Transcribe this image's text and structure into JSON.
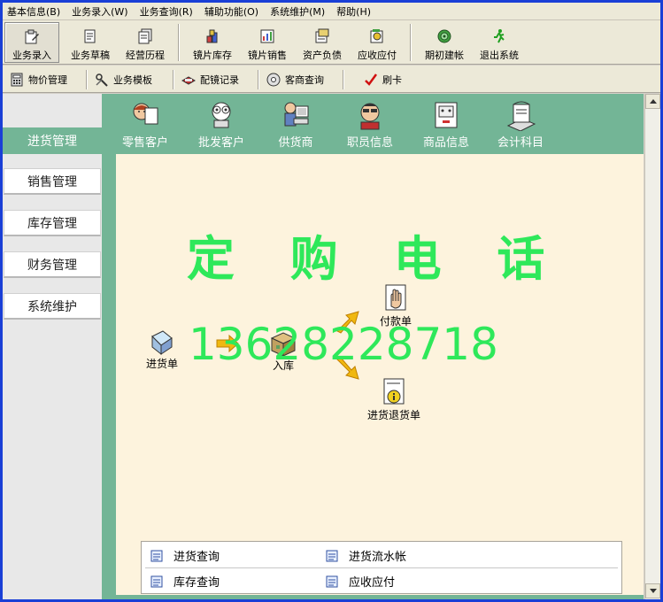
{
  "menu": [
    "基本信息(B)",
    "业务录入(W)",
    "业务查询(R)",
    "辅助功能(O)",
    "系统维护(M)",
    "帮助(H)"
  ],
  "toolbar1": {
    "items": [
      {
        "label": "业务录入",
        "icon": "edit-doc-icon"
      },
      {
        "label": "业务草稿",
        "icon": "draft-doc-icon"
      },
      {
        "label": "经营历程",
        "icon": "history-doc-icon"
      },
      {
        "label": "镜片库存",
        "icon": "stock-icon"
      },
      {
        "label": "镜片销售",
        "icon": "sales-icon"
      },
      {
        "label": "资产负债",
        "icon": "balance-icon"
      },
      {
        "label": "应收应付",
        "icon": "receivable-icon"
      },
      {
        "label": "期初建帐",
        "icon": "target-icon"
      },
      {
        "label": "退出系统",
        "icon": "exit-runner-icon"
      }
    ]
  },
  "toolbar2": {
    "items": [
      {
        "label": "物价管理",
        "icon": "calculator-icon"
      },
      {
        "label": "业务模板",
        "icon": "template-icon"
      },
      {
        "label": "配镜记录",
        "icon": "glasses-icon"
      },
      {
        "label": "客商查询",
        "icon": "cd-icon"
      },
      {
        "label": "刷卡",
        "icon": "check-icon"
      }
    ]
  },
  "sidebar": {
    "active": "进货管理",
    "items": [
      "销售管理",
      "库存管理",
      "财务管理",
      "系统维护"
    ]
  },
  "ribbon": [
    "零售客户",
    "批发客户",
    "供货商",
    "职员信息",
    "商品信息",
    "会计科目"
  ],
  "banner": {
    "title": "定 购 电 话",
    "phone": "13628228718"
  },
  "flow": {
    "purchase": "进货单",
    "storage": "入库",
    "payment": "付款单",
    "return": "进货退货单"
  },
  "quicklinks": [
    "进货查询",
    "进货流水帐",
    "库存查询",
    "应收应付"
  ],
  "colors": {
    "panel_green": "#73b596",
    "workspace_bg": "#fdf3dd",
    "banner_green": "#2ee85a",
    "window_blue": "#1a3fd6"
  }
}
